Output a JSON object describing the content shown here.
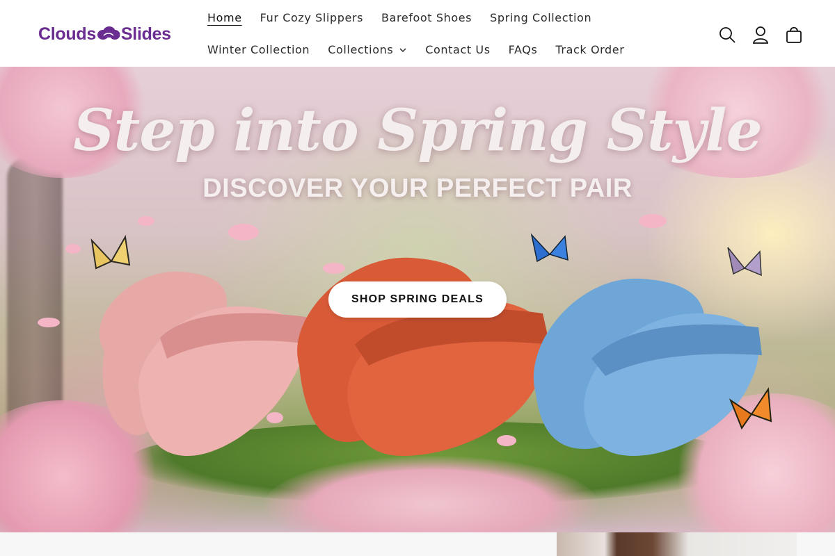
{
  "brand": {
    "logo_text_left": "Clouds",
    "logo_text_right": "Slides",
    "logo_icon": "cloud-slide-icon",
    "color": "#6a2c91"
  },
  "nav": {
    "row1": [
      {
        "label": "Home",
        "active": true
      },
      {
        "label": "Fur Cozy Slippers"
      },
      {
        "label": "Barefoot Shoes"
      },
      {
        "label": "Spring Collection"
      }
    ],
    "row2": [
      {
        "label": "Winter Collection"
      },
      {
        "label": "Collections",
        "dropdown": true
      },
      {
        "label": "Contact Us"
      },
      {
        "label": "FAQs"
      },
      {
        "label": "Track Order"
      }
    ]
  },
  "header_icons": [
    "search-icon",
    "account-icon",
    "cart-icon"
  ],
  "hero": {
    "title": "Step into Spring Style",
    "subtitle": "DISCOVER YOUR PERFECT PAIR",
    "cta_label": "SHOP SPRING DEALS",
    "slide_colors": [
      "#e7a9a6",
      "#e2643f",
      "#7eb3e1"
    ]
  }
}
